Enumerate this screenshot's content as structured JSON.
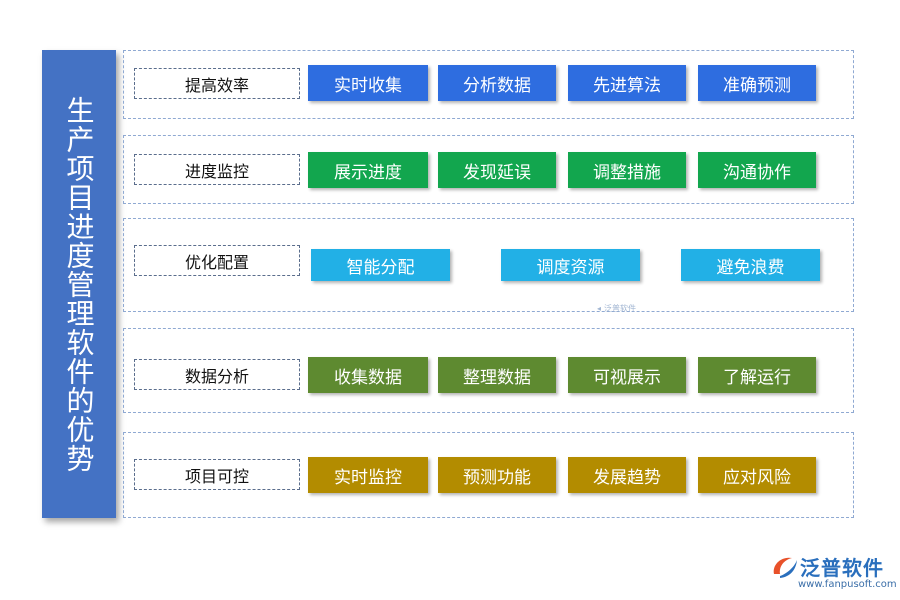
{
  "title": "生产项目进度管理软件的优势",
  "rows": [
    {
      "category": "提高效率",
      "color": "#2e6de0",
      "items": [
        "实时收集",
        "分析数据",
        "先进算法",
        "准确预测"
      ]
    },
    {
      "category": "进度监控",
      "color": "#12a64e",
      "items": [
        "展示进度",
        "发现延误",
        "调整措施",
        "沟通协作"
      ]
    },
    {
      "category": "优化配置",
      "color": "#22b0e6",
      "items": [
        "智能分配",
        "调度资源",
        "避免浪费"
      ]
    },
    {
      "category": "数据分析",
      "color": "#5e8a30",
      "items": [
        "收集数据",
        "整理数据",
        "可视展示",
        "了解运行"
      ]
    },
    {
      "category": "项目可控",
      "color": "#b38c00",
      "items": [
        "实时监控",
        "预测功能",
        "发展趋势",
        "应对风险"
      ]
    }
  ],
  "watermark": "泛普软件",
  "logo": {
    "name": "泛普软件",
    "url": "www.fanpusoft.com",
    "icon": "fanpu-logo-icon"
  }
}
